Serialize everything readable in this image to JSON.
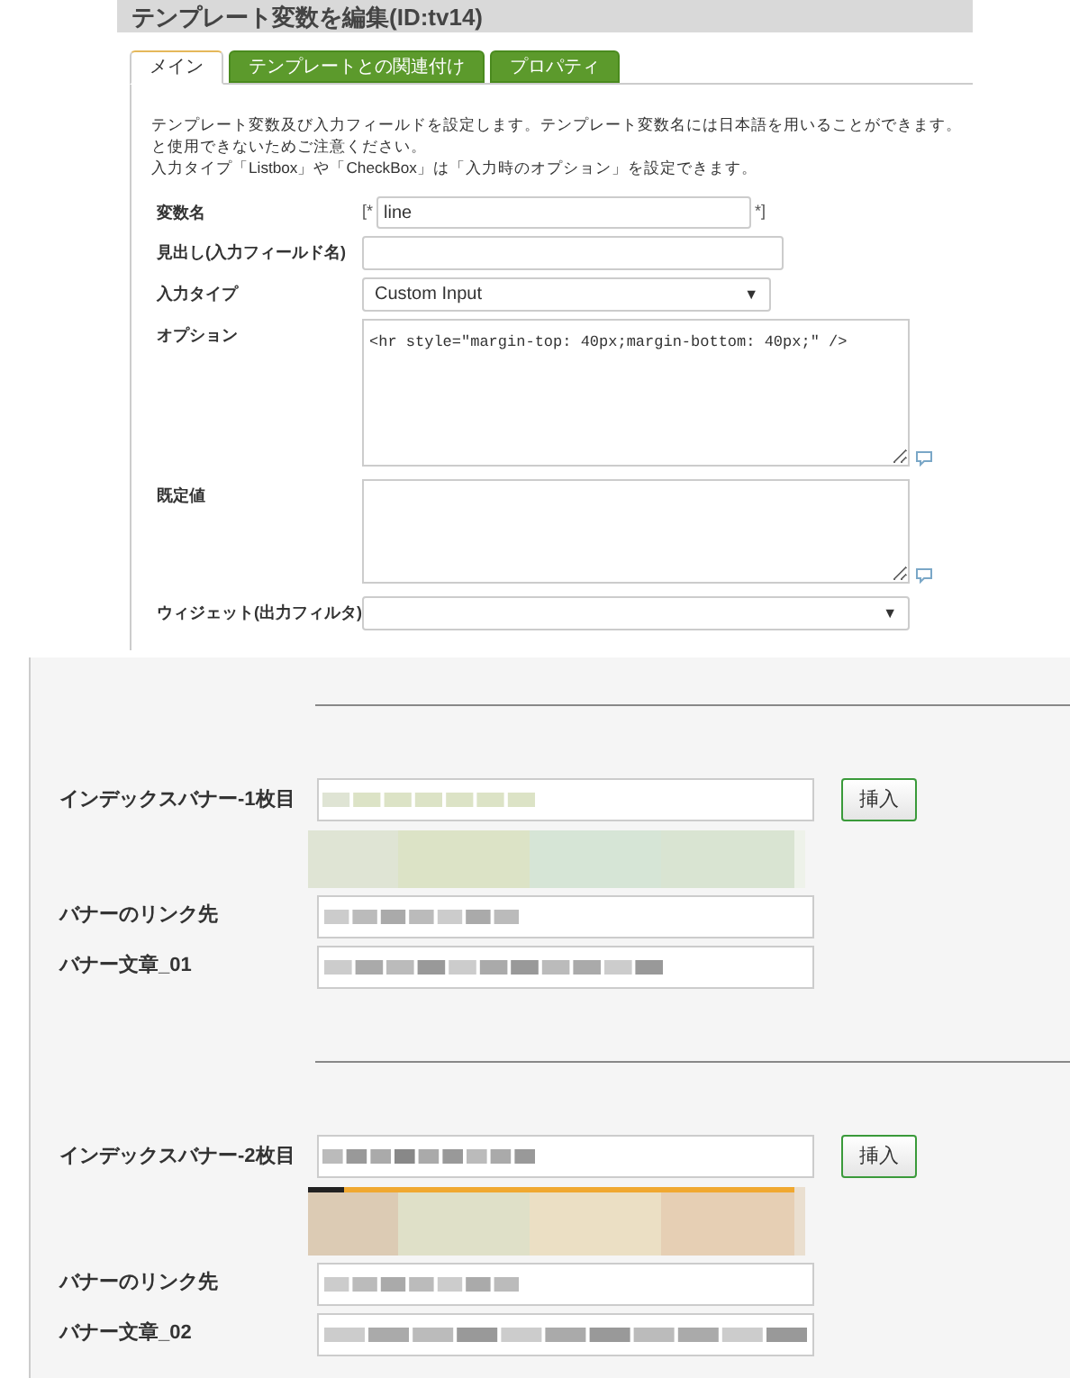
{
  "header": {
    "title": "テンプレート変数を編集(ID:tv14)"
  },
  "tabs": [
    {
      "label": "メイン",
      "selected": true
    },
    {
      "label": "テンプレートとの関連付け",
      "selected": false
    },
    {
      "label": "プロパティ",
      "selected": false
    }
  ],
  "description": [
    "テンプレート変数及び入力フィールドを設定します。テンプレート変数名には日本語を用いることができます。",
    "と使用できないためご注意ください。",
    "入力タイプ「Listbox」や「CheckBox」は「入力時のオプション」を設定できます。"
  ],
  "fields": [
    {
      "kind": "bracketed",
      "label": "変数名",
      "prefix": "[*",
      "value": "line",
      "suffix": "*]"
    },
    {
      "kind": "text",
      "label": "見出し(入力フィールド名)"
    },
    {
      "kind": "select",
      "label": "入力タイプ",
      "value": "Custom Input",
      "arrow": "▼"
    },
    {
      "kind": "textarea",
      "label": "オプション",
      "value": "<hr style=\"margin-top: 40px;margin-bottom: 40px;\" />"
    },
    {
      "kind": "textarea",
      "label": "既定値"
    },
    {
      "kind": "wide_select",
      "label": "ウィジェット(出力フィルタ)",
      "arrow": "▼"
    }
  ],
  "banners": [
    {
      "image_label": "インデックスバナー-1枚目",
      "insert_button": "挿入",
      "link_label": "バナーのリンク先",
      "text_label": "バナー文章_01"
    },
    {
      "image_label": "インデックスバナー-2枚目",
      "insert_button": "挿入",
      "link_label": "バナーのリンク先",
      "text_label": "バナー文章_02"
    }
  ]
}
